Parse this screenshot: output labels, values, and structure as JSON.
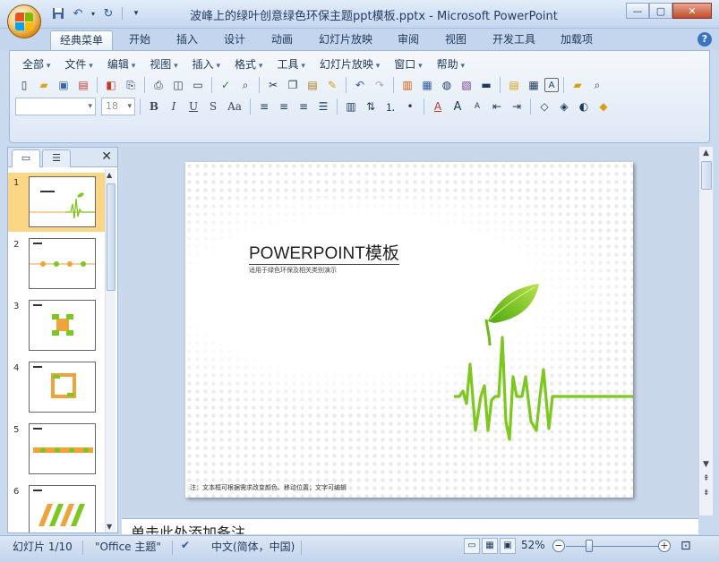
{
  "titlebar": {
    "title": "波峰上的绿叶创意绿色环保主题ppt模板.pptx - Microsoft PowerPoint",
    "minimize": "—",
    "maximize": "▢",
    "close": "✕"
  },
  "quick_access": [
    "save-icon",
    "undo-icon",
    "redo-icon",
    "customize-icon"
  ],
  "tabs": [
    "经典菜单",
    "开始",
    "插入",
    "设计",
    "动画",
    "幻灯片放映",
    "审阅",
    "视图",
    "开发工具",
    "加载项"
  ],
  "active_tab": "经典菜单",
  "menus": [
    "全部",
    "文件",
    "编辑",
    "视图",
    "插入",
    "格式",
    "工具",
    "幻灯片放映",
    "窗口",
    "帮助"
  ],
  "font": {
    "family_value": "",
    "size_value": "18"
  },
  "format_buttons": [
    "B",
    "I",
    "U",
    "S",
    "Aa"
  ],
  "slides": [
    {
      "num": "1"
    },
    {
      "num": "2"
    },
    {
      "num": "3"
    },
    {
      "num": "4"
    },
    {
      "num": "5"
    },
    {
      "num": "6"
    }
  ],
  "slide": {
    "title": "POWERPOINT模板",
    "subtitle": "适用于绿色环保及相关类别演示",
    "note": "注：文本框可根据需求改变颜色、移动位置；文字可编辑"
  },
  "notes_placeholder": "单击此处添加备注",
  "status": {
    "slide_count": "幻灯片 1/10",
    "theme": "\"Office 主题\"",
    "language": "中文(简体，中国)",
    "zoom": "52%"
  },
  "colors": {
    "accent_green": "#7dc81e",
    "accent_orange": "#f0a23b",
    "ribbon_blue": "#c4d6ee"
  }
}
